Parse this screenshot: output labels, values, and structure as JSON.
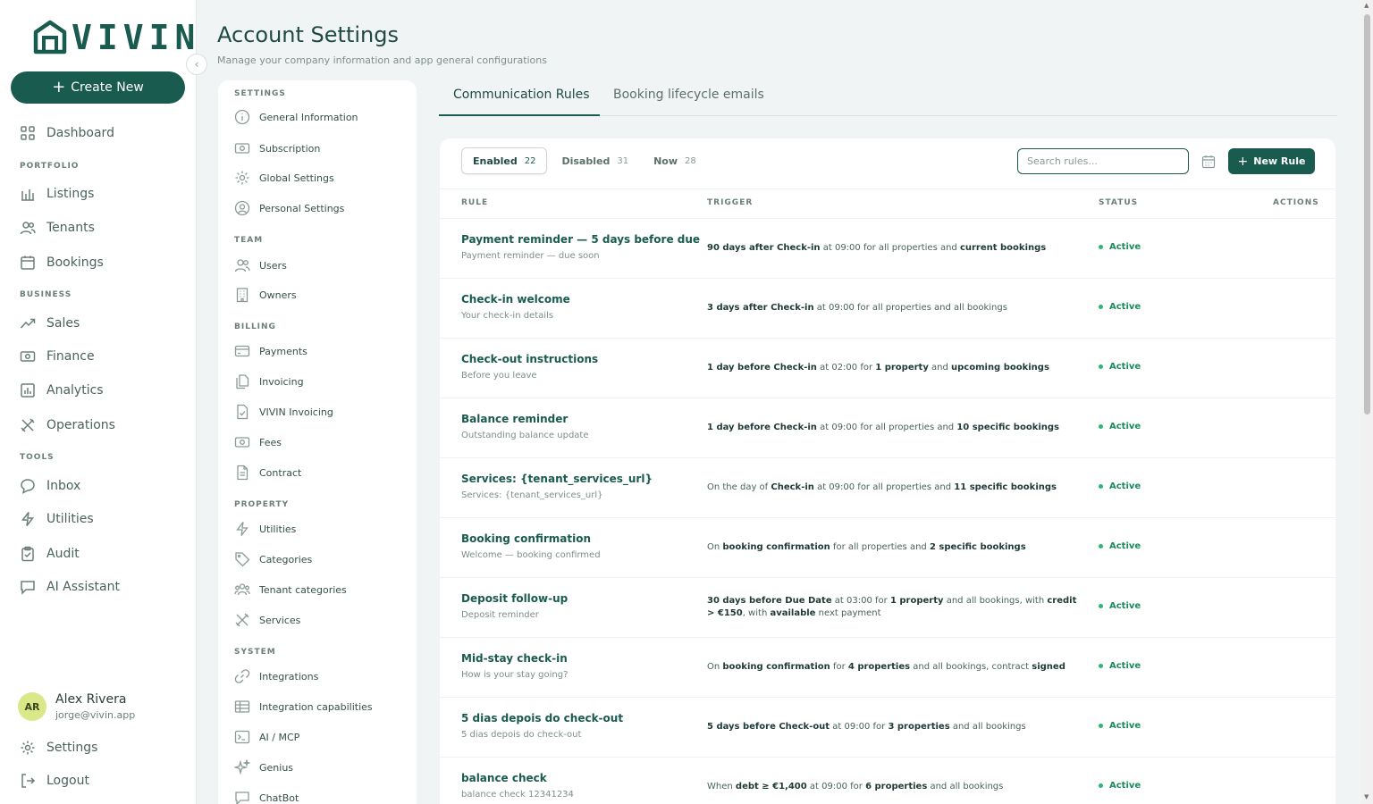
{
  "app": {
    "logo_text": "VIVIN"
  },
  "nav": {
    "create_label": "Create New",
    "dashboard": "Dashboard",
    "sections": {
      "portfolio": "PORTFOLIO",
      "business": "BUSINESS",
      "tools": "TOOLS"
    },
    "items": {
      "listings": "Listings",
      "tenants": "Tenants",
      "bookings": "Bookings",
      "sales": "Sales",
      "finance": "Finance",
      "analytics": "Analytics",
      "operations": "Operations",
      "inbox": "Inbox",
      "utilities": "Utilities",
      "audit": "Audit",
      "ai_assistant": "AI Assistant"
    },
    "user": {
      "initials": "AR",
      "name": "Alex Rivera",
      "email": "jorge@vivin.app"
    },
    "settings": "Settings",
    "logout": "Logout"
  },
  "header": {
    "title": "Account Settings",
    "subtitle": "Manage your company information and app general configurations"
  },
  "settings_menu": {
    "sections": {
      "settings": "SETTINGS",
      "team": "TEAM",
      "billing": "BILLING",
      "property": "PROPERTY",
      "system": "SYSTEM"
    },
    "items": {
      "general": "General Information",
      "subscription": "Subscription",
      "global": "Global Settings",
      "personal": "Personal Settings",
      "users": "Users",
      "owners": "Owners",
      "payments": "Payments",
      "invoicing": "Invoicing",
      "vivin_invoicing": "VIVIN Invoicing",
      "fees": "Fees",
      "contract": "Contract",
      "utilities": "Utilities",
      "categories": "Categories",
      "tenant_categories": "Tenant categories",
      "services": "Services",
      "integrations": "Integrations",
      "integration_capabilities": "Integration capabilities",
      "ai_mcp": "AI / MCP",
      "genius": "Genius",
      "chatbot": "ChatBot"
    }
  },
  "tabs": {
    "communication": "Communication Rules",
    "lifecycle": "Booking lifecycle emails"
  },
  "filters": {
    "enabled": "Enabled",
    "enabled_count": "22",
    "disabled": "Disabled",
    "disabled_count": "31",
    "now": "Now",
    "now_count": "28"
  },
  "search": {
    "placeholder": "Search rules..."
  },
  "new_rule_label": "New Rule",
  "table": {
    "headers": {
      "rule": "RULE",
      "trigger": "TRIGGER",
      "status": "STATUS",
      "actions": "ACTIONS"
    },
    "rows": [
      {
        "name": "Payment reminder — 5 days before due",
        "sub": "Payment reminder — due soon",
        "status": "Active"
      },
      {
        "name": "Check-in welcome",
        "sub": "Your check-in details",
        "status": "Active"
      },
      {
        "name": "Check-out instructions",
        "sub": "Before you leave",
        "status": "Active"
      },
      {
        "name": "Balance reminder",
        "sub": "Outstanding balance update",
        "status": "Active"
      },
      {
        "name": "Services: {tenant_services_url}",
        "sub": "Services: {tenant_services_url}",
        "status": "Active"
      },
      {
        "name": "Booking confirmation",
        "sub": "Welcome — booking confirmed",
        "status": "Active"
      },
      {
        "name": "Deposit follow-up",
        "sub": "Deposit reminder",
        "status": "Active"
      },
      {
        "name": "Mid-stay check-in",
        "sub": "How is your stay going?",
        "status": "Active"
      },
      {
        "name": "5 dias depois do check-out",
        "sub": "5 dias depois do check-out",
        "status": "Active"
      },
      {
        "name": "balance check",
        "sub": "balance check 12341234",
        "status": "Active"
      }
    ],
    "triggers": [
      {
        "a": "90 days after Check-in",
        "b": " at 09:00 for all properties and ",
        "c": "current bookings"
      },
      {
        "a": "3 days after Check-in",
        "b": " at 09:00 for all properties and all bookings"
      },
      {
        "a": "1 day before Check-in",
        "b": " at 02:00 for ",
        "c": "1 property",
        "d": " and ",
        "e": "upcoming bookings"
      },
      {
        "a": "1 day before Check-in",
        "b": " at 09:00 for all properties and ",
        "c": "10 specific bookings"
      },
      {
        "a": "On the day of ",
        "b": "Check-in",
        "c": " at 09:00 for all properties and ",
        "d": "11 specific bookings"
      },
      {
        "a": "On ",
        "b": "booking confirmation",
        "c": " for all properties and ",
        "d": "2 specific bookings"
      },
      {
        "a": "30 days before Due Date",
        "b": " at 03:00 for ",
        "c": "1 property",
        "d": " and all bookings, with ",
        "e": "credit > €150",
        "f": ", with ",
        "g": "available",
        "h": " next payment"
      },
      {
        "a": "On ",
        "b": "booking confirmation",
        "c": " for ",
        "d": "4 properties",
        "e": " and all bookings, contract ",
        "f": "signed"
      },
      {
        "a": "5 days before Check-out",
        "b": " at 09:00 for ",
        "c": "3 properties",
        "d": " and all bookings"
      },
      {
        "a": "When ",
        "b": "debt ≥ €1,400",
        "c": " at 09:00 for ",
        "d": "6 properties",
        "e": " and all bookings"
      }
    ]
  },
  "colors": {
    "brand": "#1a5b4f",
    "active_status": "#1a8a5c",
    "background": "#f1f4f5"
  }
}
